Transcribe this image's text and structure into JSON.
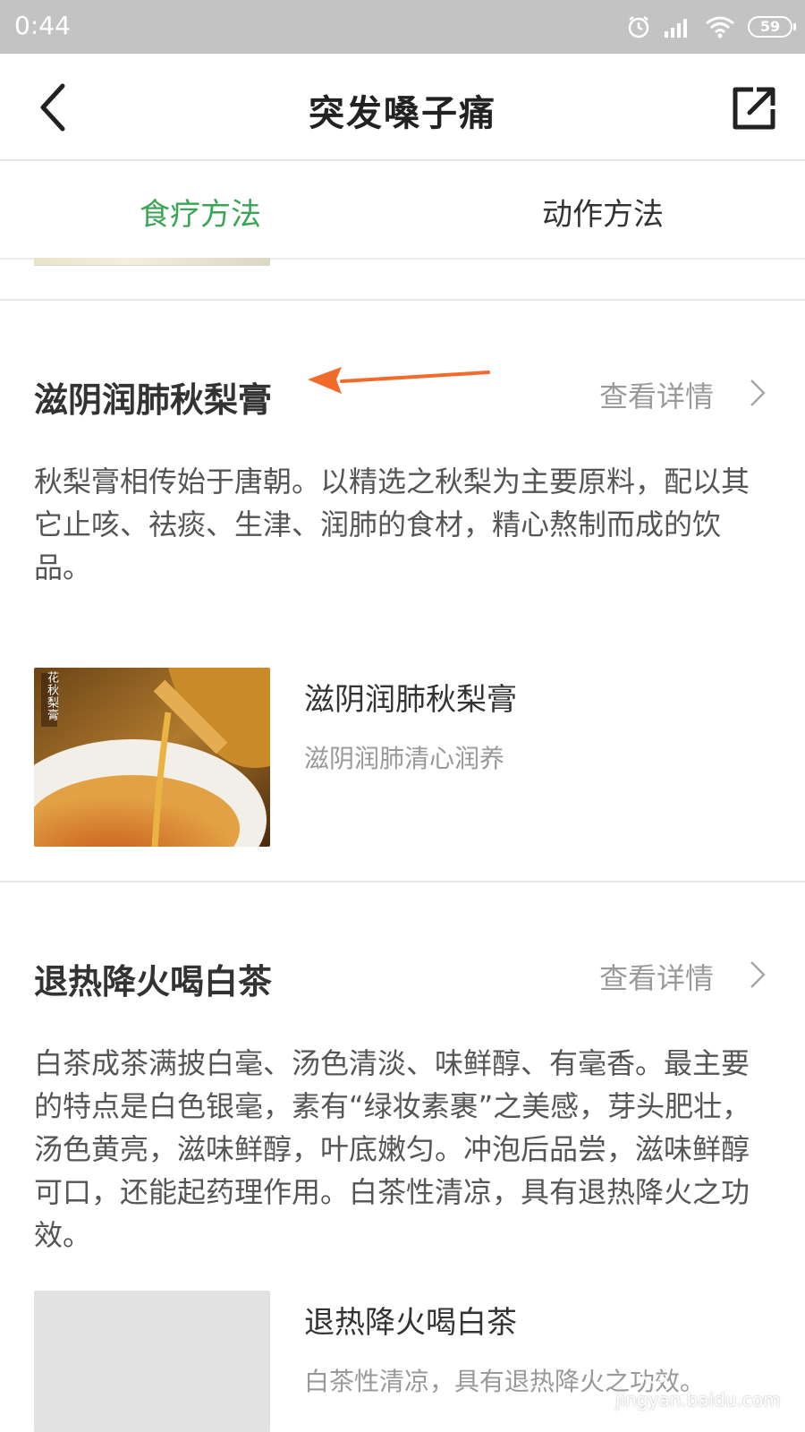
{
  "status_bar": {
    "time": "0:44",
    "battery": "59"
  },
  "nav": {
    "title": "突发嗓子痛"
  },
  "tabs": [
    {
      "label": "食疗方法",
      "active": true
    },
    {
      "label": "动作方法",
      "active": false
    }
  ],
  "sections": [
    {
      "title": "滋阴润肺秋梨膏",
      "detail_link": "查看详情",
      "description": "秋梨膏相传始于唐朝。以精选之秋梨为主要原料，配以其它止咳、祛痰、生津、润肺的食材，精心熬制而成的饮品。",
      "card": {
        "title": "滋阴润肺秋梨膏",
        "subtitle": "滋阴润肺清心润养",
        "image_caption": "花秋梨膏"
      }
    },
    {
      "title": "退热降火喝白茶",
      "detail_link": "查看详情",
      "description": "白茶成茶满披白毫、汤色清淡、味鲜醇、有毫香。最主要的特点是白色银毫，素有“绿妆素裹”之美感，芽头肥壮，汤色黄亮，滋味鲜醇，叶底嫩匀。冲泡后品尝，滋味鲜醇可口，还能起药理作用。白茶性清凉，具有退热降火之功效。",
      "card": {
        "title": "退热降火喝白茶",
        "subtitle": "白茶性清凉，具有退热降火之功效。"
      }
    }
  ],
  "watermark": {
    "text": "jingyan.baidu.com"
  },
  "colors": {
    "accent_green": "#3aa655",
    "annotation_orange": "#f26b2a",
    "status_bar_bg": "#c3c3c3"
  }
}
